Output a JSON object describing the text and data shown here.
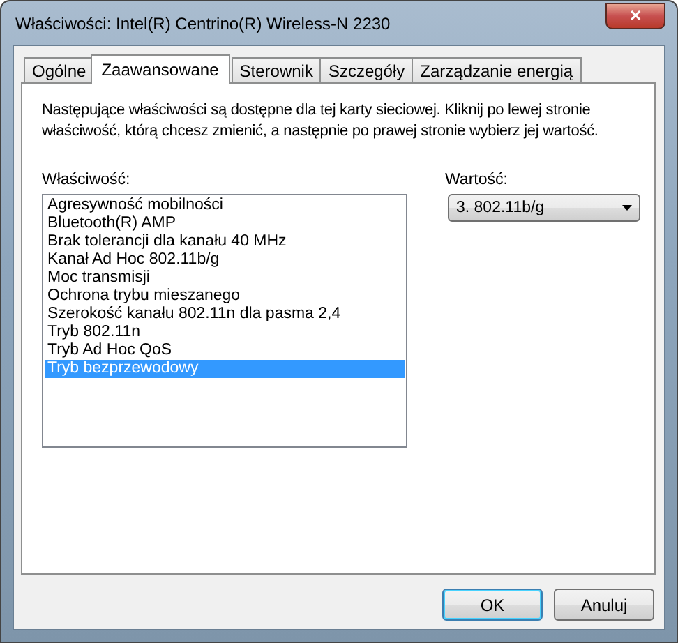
{
  "window": {
    "title": "Właściwości: Intel(R) Centrino(R) Wireless-N 2230",
    "close": "✕"
  },
  "tabs": [
    {
      "label": "Ogólne",
      "selected": false
    },
    {
      "label": "Zaawansowane",
      "selected": true
    },
    {
      "label": "Sterownik",
      "selected": false
    },
    {
      "label": "Szczegóły",
      "selected": false
    },
    {
      "label": "Zarządzanie energią",
      "selected": false
    }
  ],
  "description": "Następujące właściwości są dostępne dla tej karty sieciowej. Kliknij po lewej stronie właściwość, którą chcesz zmienić, a następnie po prawej stronie wybierz jej wartość.",
  "property": {
    "label": "Właściwość:",
    "items": [
      {
        "label": "Agresywność mobilności",
        "selected": false
      },
      {
        "label": "Bluetooth(R) AMP",
        "selected": false
      },
      {
        "label": "Brak tolerancji dla kanału 40 MHz",
        "selected": false
      },
      {
        "label": "Kanał Ad Hoc 802.11b/g",
        "selected": false
      },
      {
        "label": "Moc transmisji",
        "selected": false
      },
      {
        "label": "Ochrona trybu mieszanego",
        "selected": false
      },
      {
        "label": "Szerokość kanału 802.11n dla pasma 2,4",
        "selected": false
      },
      {
        "label": "Tryb 802.11n",
        "selected": false
      },
      {
        "label": "Tryb Ad Hoc QoS",
        "selected": false
      },
      {
        "label": "Tryb bezprzewodowy",
        "selected": true
      }
    ]
  },
  "value": {
    "label": "Wartość:",
    "selected_value": "3. 802.11b/g"
  },
  "buttons": [
    {
      "label": "OK",
      "default": true
    },
    {
      "label": "Anuluj",
      "default": false
    }
  ]
}
